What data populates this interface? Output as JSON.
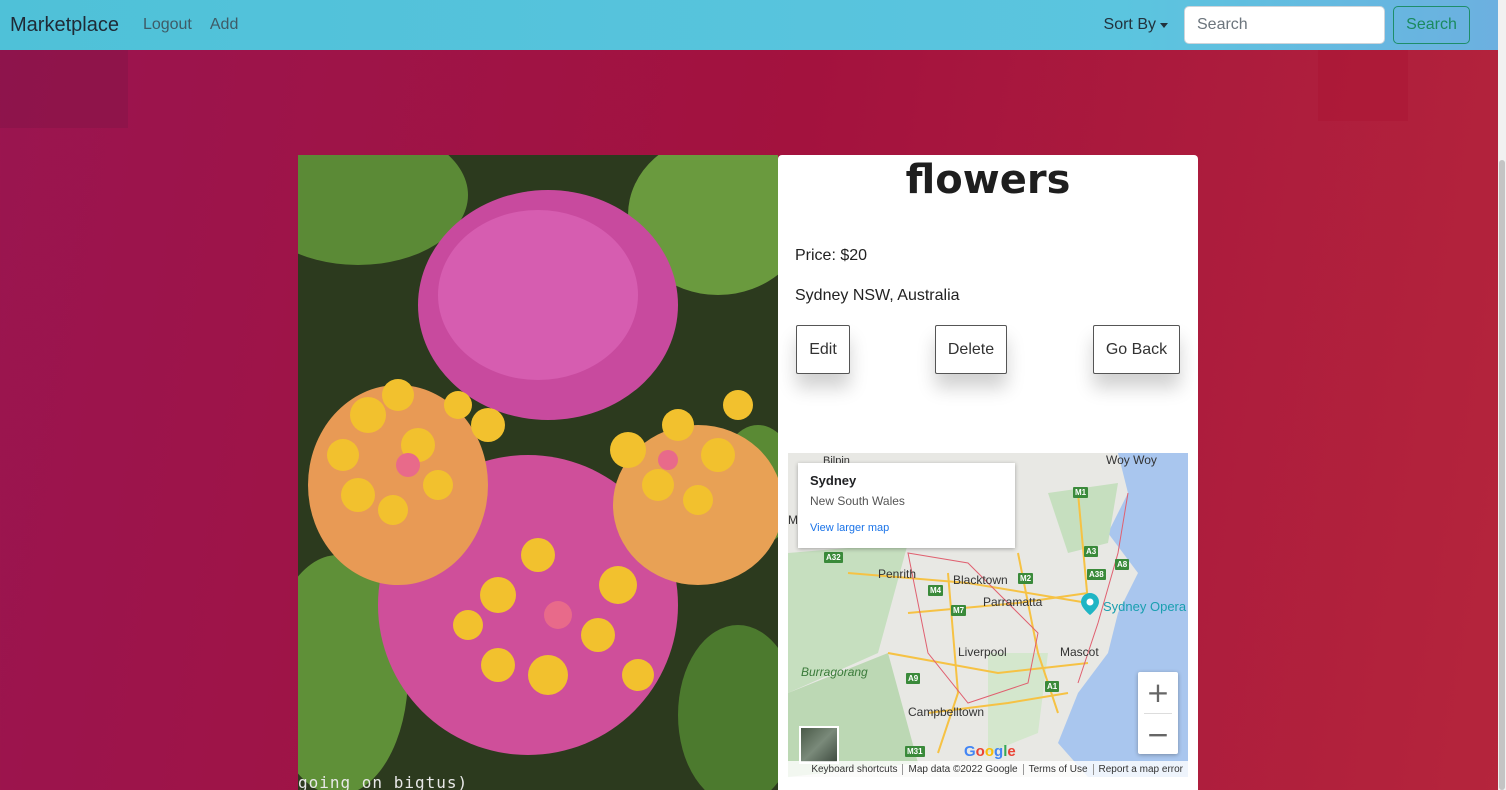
{
  "navbar": {
    "brand": "Marketplace",
    "links": [
      "Logout",
      "Add"
    ],
    "sort_label": "Sort By",
    "search_placeholder": "Search",
    "search_button": "Search"
  },
  "listing": {
    "title": "flowers",
    "price": "Price: $20",
    "location": "Sydney NSW, Australia",
    "image_caption": "going on bigtus)",
    "buttons": {
      "edit": "Edit",
      "delete": "Delete",
      "back": "Go Back"
    }
  },
  "map": {
    "info_title": "Sydney",
    "info_subtitle": "New South Wales",
    "info_link": "View larger map",
    "labels": {
      "bilpin": "Bilpin",
      "woy_woy": "Woy Woy",
      "penrith": "Penrith",
      "blacktown": "Blacktown",
      "parramatta": "Parramatta",
      "sydney_opera": "Sydney Opera",
      "liverpool": "Liverpool",
      "mascot": "Mascot",
      "burragorang": "Burragorang",
      "campbelltown": "Campbelltown",
      "edge_mo": "Mo"
    },
    "shields": [
      "M1",
      "A3",
      "A38",
      "A8",
      "A32",
      "M2",
      "M4",
      "M7",
      "A9",
      "A1",
      "M31"
    ],
    "google_logo": "Google",
    "zoom_in": "+",
    "zoom_out": "−",
    "attribution": [
      "Keyboard shortcuts",
      "Map data ©2022 Google",
      "Terms of Use",
      "Report a map error"
    ],
    "colors": {
      "water": "#a9c6ee",
      "land": "#e8e8e4",
      "park": "#c6dfbf",
      "road": "#f6c244",
      "border": "#e06070",
      "opera_pin": "#1fb5c4"
    }
  },
  "colors": {
    "navbar_start": "#4fc1d8",
    "background": "#a3123e",
    "search_button": "#1a8a5f"
  }
}
